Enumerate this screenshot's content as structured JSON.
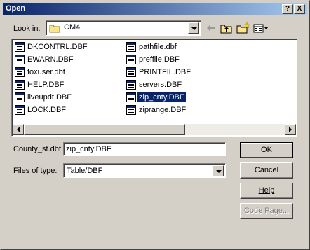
{
  "window": {
    "title": "Open"
  },
  "titlebar_buttons": {
    "help": "?",
    "close": "X"
  },
  "look_in": {
    "label_pre": "Look ",
    "label_u": "i",
    "label_post": "n:",
    "value": "CM4"
  },
  "files": [
    {
      "name": "DKCONTRL.DBF",
      "selected": false
    },
    {
      "name": "EWARN.DBF",
      "selected": false
    },
    {
      "name": "foxuser.dbf",
      "selected": false
    },
    {
      "name": "HELP.DBF",
      "selected": false
    },
    {
      "name": "liveupdt.DBF",
      "selected": false
    },
    {
      "name": "LOCK.DBF",
      "selected": false
    },
    {
      "name": "pathfile.dbf",
      "selected": false
    },
    {
      "name": "preffile.DBF",
      "selected": false
    },
    {
      "name": "PRINTFIL.DBF",
      "selected": false
    },
    {
      "name": "servers.DBF",
      "selected": false
    },
    {
      "name": "zip_cnty.DBF",
      "selected": true
    },
    {
      "name": "ziprange.DBF",
      "selected": false
    }
  ],
  "filename": {
    "label": "County_st.dbf",
    "value": "zip_cnty.DBF"
  },
  "filetype": {
    "label_pre": "Files of ",
    "label_u": "t",
    "label_post": "ype:",
    "value": "Table/DBF"
  },
  "buttons": {
    "ok": "OK",
    "cancel": "Cancel",
    "help": "Help",
    "code_page": "Code Page..."
  },
  "icons": {
    "back": "back-arrow-icon",
    "up": "up-one-level-icon",
    "new_folder": "new-folder-icon",
    "view": "view-menu-icon",
    "file": "dbf-file-icon",
    "folder": "folder-icon"
  },
  "colors": {
    "title_start": "#0a246a",
    "title_end": "#a6caf0",
    "selection": "#0a246a",
    "face": "#d4d0c8"
  }
}
